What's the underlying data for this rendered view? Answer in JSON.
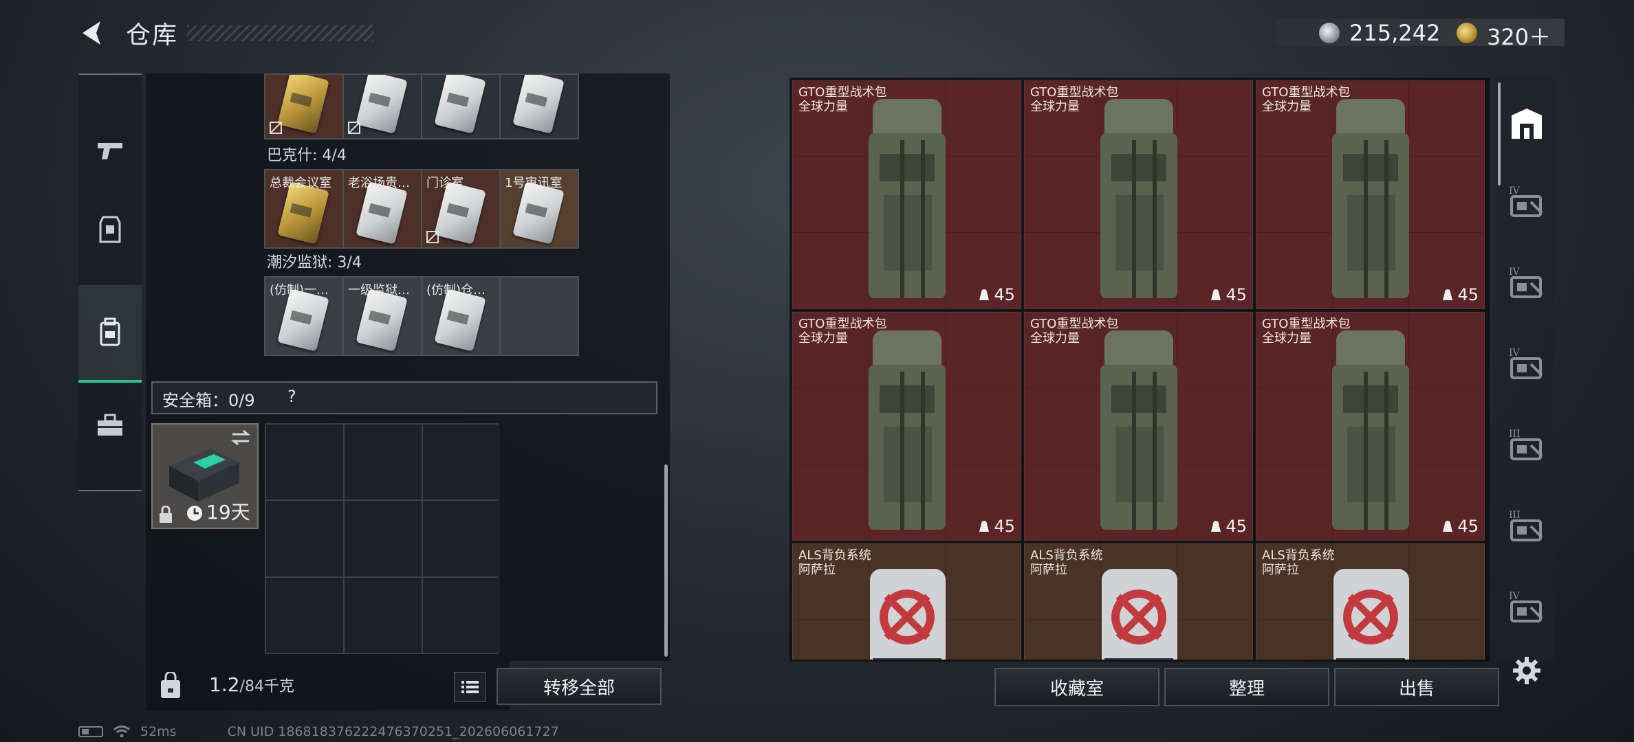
{
  "header": {
    "title": "仓库",
    "silver": "215,242",
    "gold": "320＋"
  },
  "sidebar": {
    "items": [
      "weapons",
      "armor",
      "backpack",
      "toolbox"
    ],
    "active": 2
  },
  "left": {
    "top_row": [
      {
        "label": "",
        "style": "gold",
        "nolink": true
      },
      {
        "label": "",
        "style": "dark",
        "nolink": true
      },
      {
        "label": "",
        "style": "dark",
        "nolink": false
      },
      {
        "label": "",
        "style": "dark",
        "nolink": false
      }
    ],
    "section_bakeshi": "巴克什: 4/4",
    "bakeshi_cards": [
      {
        "label": "总裁会议室",
        "style": "gold",
        "nolink": false,
        "card": "goldcard"
      },
      {
        "label": "老浴场贵…",
        "style": "gold",
        "nolink": false,
        "card": "white"
      },
      {
        "label": "门诊室",
        "style": "gold",
        "nolink": true,
        "card": "white"
      },
      {
        "label": "1号审讯室",
        "style": "gold2",
        "nolink": false,
        "card": "white"
      }
    ],
    "section_chaoxi": "潮汐监狱: 3/4",
    "chaoxi_cards": [
      {
        "label": "(仿制)一…",
        "style": "grey",
        "nolink": false,
        "card": "white"
      },
      {
        "label": "一级监狱…",
        "style": "grey",
        "nolink": false,
        "card": "white"
      },
      {
        "label": "(仿制)仓…",
        "style": "grey",
        "nolink": false,
        "card": "white"
      },
      {
        "label": "",
        "style": "grey",
        "nolink": false,
        "card": "none"
      }
    ],
    "safe_label": "安全箱：0/9",
    "safe_help": "?",
    "safe_days": "19天",
    "weight_current": "1.2",
    "weight_capacity": "/84千克",
    "transfer_all": "转移全部"
  },
  "storage": {
    "items": [
      {
        "name": "GTO重型战术包\n全球力量",
        "count": "45",
        "color": "red"
      },
      {
        "name": "GTO重型战术包\n全球力量",
        "count": "45",
        "color": "red"
      },
      {
        "name": "GTO重型战术包\n全球力量",
        "count": "45",
        "color": "red"
      },
      {
        "name": "GTO重型战术包\n全球力量",
        "count": "45",
        "color": "red"
      },
      {
        "name": "GTO重型战术包\n全球力量",
        "count": "45",
        "color": "red"
      },
      {
        "name": "GTO重型战术包\n全球力量",
        "count": "45",
        "color": "red"
      },
      {
        "name": "ALS背负系统\n阿萨拉",
        "count": "",
        "color": "brown"
      },
      {
        "name": "ALS背负系统\n阿萨拉",
        "count": "",
        "color": "brown"
      },
      {
        "name": "ALS背负系统\n阿萨拉",
        "count": "",
        "color": "brown"
      }
    ],
    "tabs": [
      "home",
      "IV",
      "IV",
      "IV",
      "III",
      "III",
      "IV"
    ]
  },
  "buttons": {
    "collection": "收藏室",
    "sort": "整理",
    "sell": "出售"
  },
  "status": {
    "ping": "52ms",
    "uid": "CN UID 1868183762224763702​51_202606061727"
  },
  "colors": {
    "accent": "#29c48a",
    "item_red": "#5b2426",
    "item_brown": "#4a3326"
  }
}
